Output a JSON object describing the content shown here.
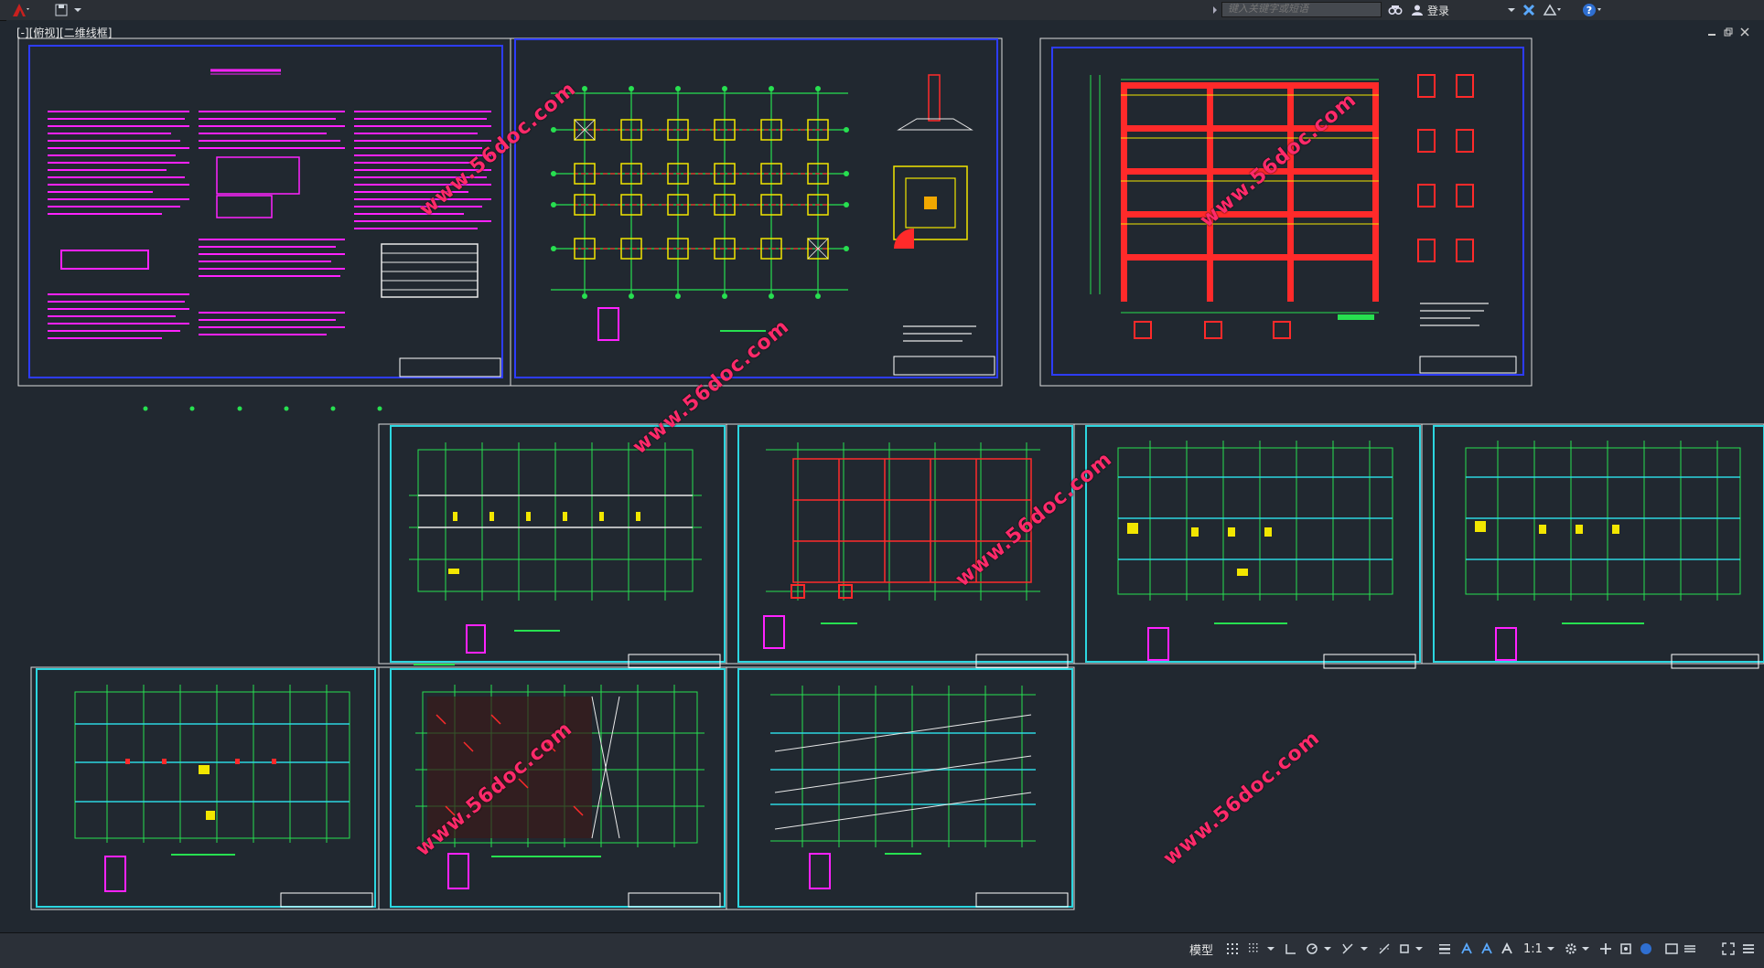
{
  "title_bar": {
    "search_placeholder": "键入关键字或短语",
    "login_label": "登录"
  },
  "viewport": {
    "label": "[-][俯视][二维线框]"
  },
  "watermark": "www.56doc.com",
  "status_bar": {
    "model_tab": "模型",
    "annotation_scale": "1:1"
  },
  "colors": {
    "background": "#212830",
    "sheet_border_blue": "#2d3cff",
    "sheet_border_cyan": "#2cd6e0",
    "grid_green": "#27e050",
    "beam_red": "#ff2a2a",
    "text_magenta": "#ff22ff",
    "column_yellow": "#f2e600",
    "watermark": "#ff2a6a"
  },
  "icons": {
    "app_menu": "autocad-logo-icon",
    "search": "search-icon",
    "login": "user-icon",
    "help": "help-icon"
  }
}
